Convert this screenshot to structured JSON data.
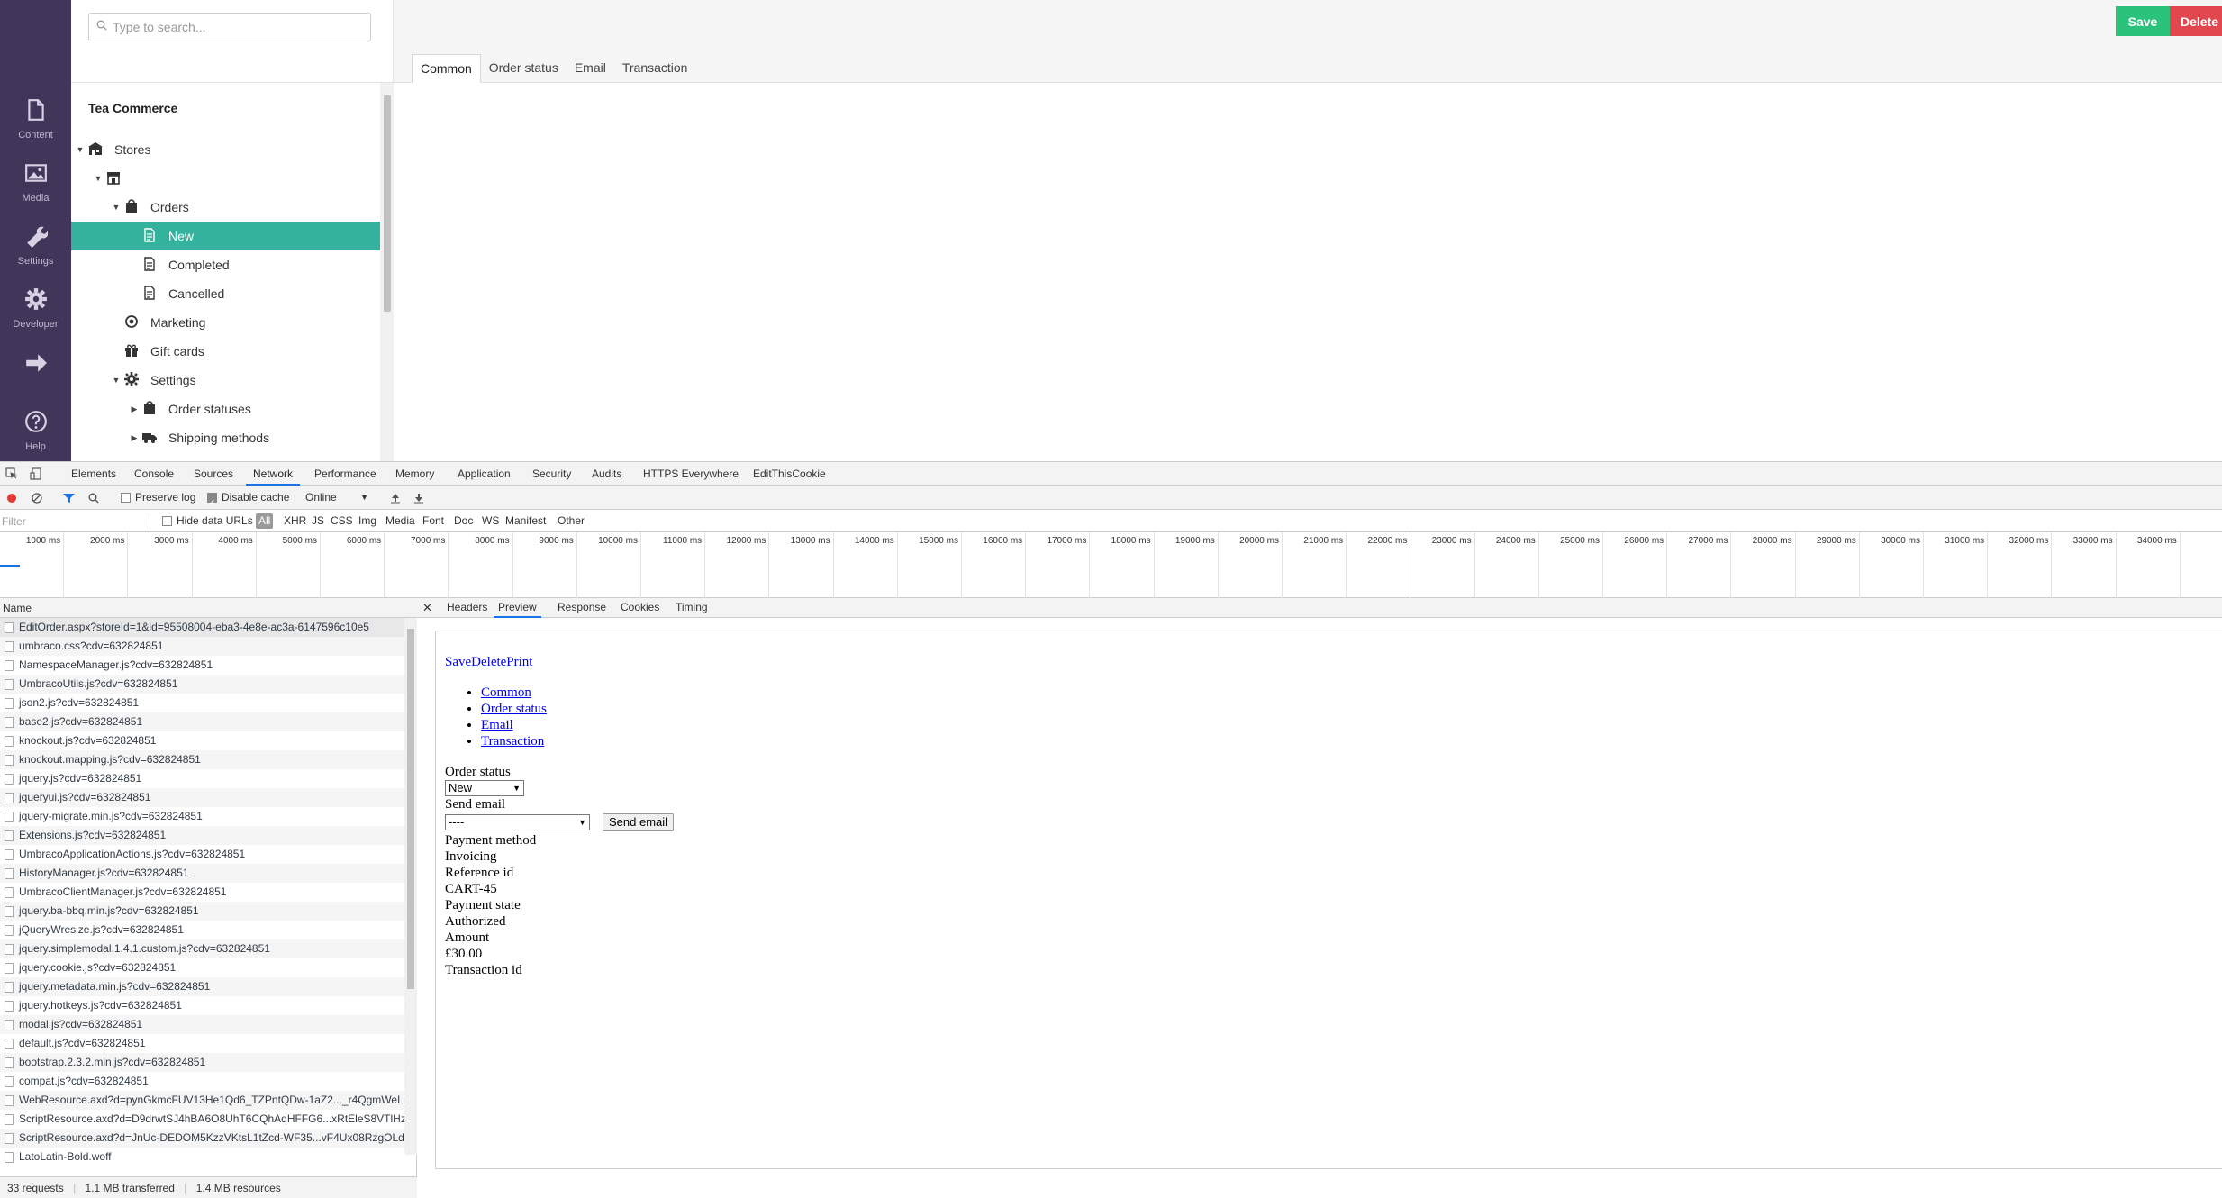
{
  "left_nav": [
    {
      "label": "Content",
      "icon": "document-icon"
    },
    {
      "label": "Media",
      "icon": "image-icon"
    },
    {
      "label": "Settings",
      "icon": "wrench-icon"
    },
    {
      "label": "Developer",
      "icon": "gear-icon"
    },
    {
      "label": "",
      "icon": "arrow-right-icon"
    },
    {
      "label": "Help",
      "icon": "help-icon"
    }
  ],
  "tree": {
    "search_placeholder": "Type to search...",
    "section_title": "Tea Commerce",
    "items": [
      {
        "label": "Stores",
        "caret": "▼",
        "icon": "stores-icon"
      },
      {
        "label": "",
        "caret": "▼",
        "icon": "store-icon"
      },
      {
        "label": "Orders",
        "caret": "▼",
        "icon": "orders-icon"
      },
      {
        "label": "New",
        "caret": "",
        "icon": "order-list-icon",
        "active": true
      },
      {
        "label": "Completed",
        "caret": "",
        "icon": "order-list-icon"
      },
      {
        "label": "Cancelled",
        "caret": "",
        "icon": "order-list-icon"
      },
      {
        "label": "Marketing",
        "caret": "",
        "icon": "target-icon"
      },
      {
        "label": "Gift cards",
        "caret": "",
        "icon": "gift-icon"
      },
      {
        "label": "Settings",
        "caret": "▼",
        "icon": "settings-icon"
      },
      {
        "label": "Order statuses",
        "caret": "▶",
        "icon": "orders-icon"
      },
      {
        "label": "Shipping methods",
        "caret": "▶",
        "icon": "truck-icon"
      }
    ]
  },
  "editor": {
    "save_label": "Save",
    "delete_label": "Delete",
    "tabs": [
      "Common",
      "Order status",
      "Email",
      "Transaction"
    ]
  },
  "devtools": {
    "tabs": [
      "Elements",
      "Console",
      "Sources",
      "Network",
      "Performance",
      "Memory",
      "Application",
      "Security",
      "Audits",
      "HTTPS Everywhere",
      "EditThisCookie"
    ],
    "active_tab": "Network",
    "toolbar": {
      "preserve_log": "Preserve log",
      "disable_cache": "Disable cache",
      "throttle": "Online"
    },
    "filter": {
      "placeholder": "Filter",
      "hide_data_urls": "Hide data URLs",
      "types": [
        "All",
        "XHR",
        "JS",
        "CSS",
        "Img",
        "Media",
        "Font",
        "Doc",
        "WS",
        "Manifest",
        "Other"
      ]
    },
    "timeline_ticks": [
      "1000 ms",
      "2000 ms",
      "3000 ms",
      "4000 ms",
      "5000 ms",
      "6000 ms",
      "7000 ms",
      "8000 ms",
      "9000 ms",
      "10000 ms",
      "11000 ms",
      "12000 ms",
      "13000 ms",
      "14000 ms",
      "15000 ms",
      "16000 ms",
      "17000 ms",
      "18000 ms",
      "19000 ms",
      "20000 ms",
      "21000 ms",
      "22000 ms",
      "23000 ms",
      "24000 ms",
      "25000 ms",
      "26000 ms",
      "27000 ms",
      "28000 ms",
      "29000 ms",
      "30000 ms",
      "31000 ms",
      "32000 ms",
      "33000 ms",
      "34000 ms",
      "350"
    ],
    "requests_header": "Name",
    "requests": [
      "EditOrder.aspx?storeId=1&id=95508004-eba3-4e8e-ac3a-6147596c10e5",
      "umbraco.css?cdv=632824851",
      "NamespaceManager.js?cdv=632824851",
      "UmbracoUtils.js?cdv=632824851",
      "json2.js?cdv=632824851",
      "base2.js?cdv=632824851",
      "knockout.js?cdv=632824851",
      "knockout.mapping.js?cdv=632824851",
      "jquery.js?cdv=632824851",
      "jqueryui.js?cdv=632824851",
      "jquery-migrate.min.js?cdv=632824851",
      "Extensions.js?cdv=632824851",
      "UmbracoApplicationActions.js?cdv=632824851",
      "HistoryManager.js?cdv=632824851",
      "UmbracoClientManager.js?cdv=632824851",
      "jquery.ba-bbq.min.js?cdv=632824851",
      "jQueryWresize.js?cdv=632824851",
      "jquery.simplemodal.1.4.1.custom.js?cdv=632824851",
      "jquery.cookie.js?cdv=632824851",
      "jquery.metadata.min.js?cdv=632824851",
      "jquery.hotkeys.js?cdv=632824851",
      "modal.js?cdv=632824851",
      "default.js?cdv=632824851",
      "bootstrap.2.3.2.min.js?cdv=632824851",
      "compat.js?cdv=632824851",
      "WebResource.axd?d=pynGkmcFUV13He1Qd6_TZPntQDw-1aZ2..._r4QgmWeLL4-",
      "ScriptResource.axd?d=D9drwtSJ4hBA6O8UhT6CQhAqHFFG6...xRtEleS8VTlHz-0o",
      "ScriptResource.axd?d=JnUc-DEDOM5KzzVKtsL1tZcd-WF35...vF4Ux08RzgOLdQ6.",
      "LatoLatin-Bold.woff"
    ],
    "status": {
      "requests": "33 requests",
      "transferred": "1.1 MB transferred",
      "resources": "1.4 MB resources"
    },
    "detail_tabs": [
      "Headers",
      "Preview",
      "Response",
      "Cookies",
      "Timing"
    ],
    "detail_active": "Preview",
    "preview": {
      "top_link": "SaveDeletePrint",
      "links": [
        "Common",
        "Order status",
        "Email",
        "Transaction"
      ],
      "order_status_label": "Order status",
      "order_status_value": "New",
      "send_email_label": "Send email",
      "send_email_value": "----",
      "send_email_button": "Send email",
      "lines": [
        "Payment method",
        "Invoicing",
        "Reference id",
        "CART-45",
        "Payment state",
        "Authorized",
        "Amount",
        "£30.00",
        "Transaction id"
      ]
    }
  }
}
